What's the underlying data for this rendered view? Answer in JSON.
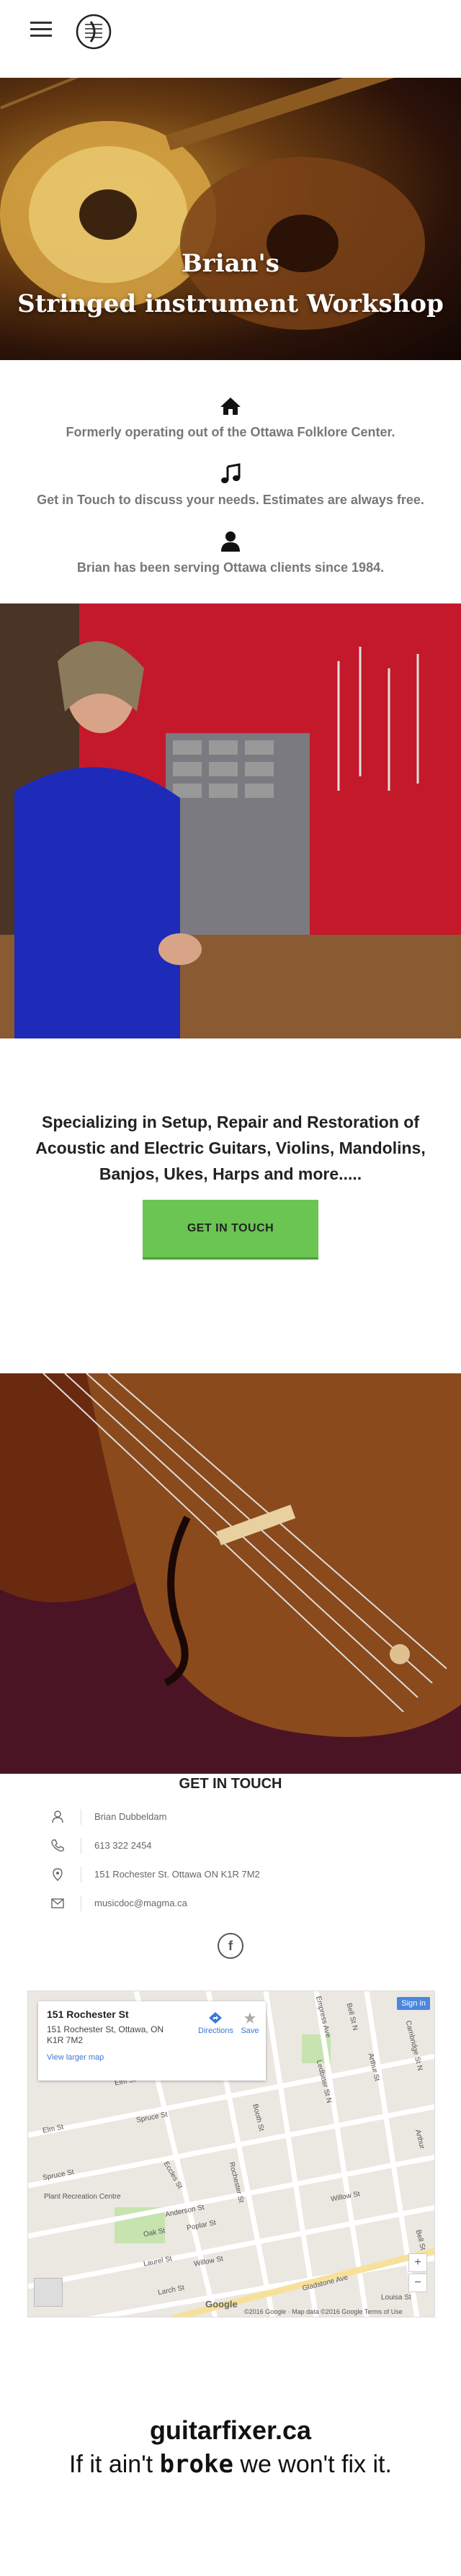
{
  "header": {
    "menu_icon": "hamburger-menu-icon",
    "logo_icon": "logo-icon"
  },
  "hero": {
    "title_line1": "Brian's",
    "title_line2": "Stringed instrument Workshop"
  },
  "features": [
    {
      "icon": "home-icon",
      "text": "Formerly operating out of the Ottawa Folklore Center."
    },
    {
      "icon": "music-note-icon",
      "text": "Get in Touch to discuss your needs. Estimates are always free."
    },
    {
      "icon": "user-icon",
      "text": "Brian has been serving Ottawa clients since 1984."
    }
  ],
  "specializing": {
    "line1": "Specializing in Setup, Repair and Restoration of",
    "line2": "Acoustic and Electric Guitars, Violins, Mandolins,",
    "line3": "Banjos, Ukes, Harps and more....."
  },
  "cta_label": "GET IN TOUCH",
  "contact": {
    "title": "GET IN TOUCH",
    "name": "Brian Dubbeldam",
    "phone": "613 322 2454",
    "address": "151 Rochester St. Ottawa ON K1R 7M2",
    "email": "musicdoc@magma.ca"
  },
  "facebook_label": "f",
  "map": {
    "place": "151 Rochester St",
    "address": "151 Rochester St, Ottawa, ON K1R 7M2",
    "larger_map": "View larger map",
    "directions": "Directions",
    "save": "Save",
    "sign_in": "Sign in",
    "zoom_in": "+",
    "zoom_out": "−",
    "attribution": "©2016 Google · Map data ©2016 Google   Terms of Use",
    "google_logo": "Google",
    "streets": [
      "Elm St",
      "Spruce St",
      "Spruce St",
      "Eccles St",
      "Booth St",
      "Rochester St",
      "Ledbitter St N",
      "Arthur St",
      "Cambridge St N",
      "Empress Ave",
      "Bell St N",
      "Plant Recreation Centre",
      "Anderson St",
      "Oak St",
      "Poplar St",
      "Willow St",
      "Laurel St",
      "Larch St",
      "Willow St",
      "Gladstone Ave",
      "Louisa St",
      "Arthur",
      "Bell St"
    ]
  },
  "footer": {
    "domain": "guitarfixer.ca",
    "slogan_before": "If it ain't ",
    "slogan_broke": "broke",
    "slogan_after": " we won't fix it."
  }
}
